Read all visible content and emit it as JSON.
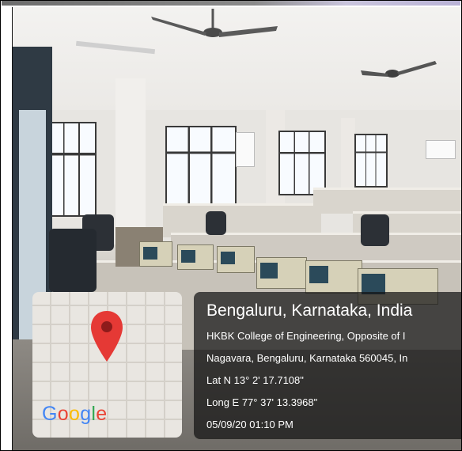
{
  "photo": {
    "subject": "laboratory-room",
    "colors": {
      "overlay": "#141414",
      "pin": "#e53935",
      "map_bg": "#e9e6e1"
    }
  },
  "map_card": {
    "icon": "location-pin-icon",
    "logo_text": "Google",
    "logo_letters": [
      "G",
      "o",
      "o",
      "g",
      "l",
      "e"
    ]
  },
  "location": {
    "city": "Bengaluru, Karnataka, India",
    "address_line1": "HKBK College of Engineering, Opposite of I",
    "address_line2": "Nagavara, Bengaluru, Karnataka 560045, In",
    "latitude": "Lat N 13° 2' 17.7108\"",
    "longitude": "Long E 77° 37' 13.3968\"",
    "timestamp": "05/09/20 01:10 PM"
  }
}
